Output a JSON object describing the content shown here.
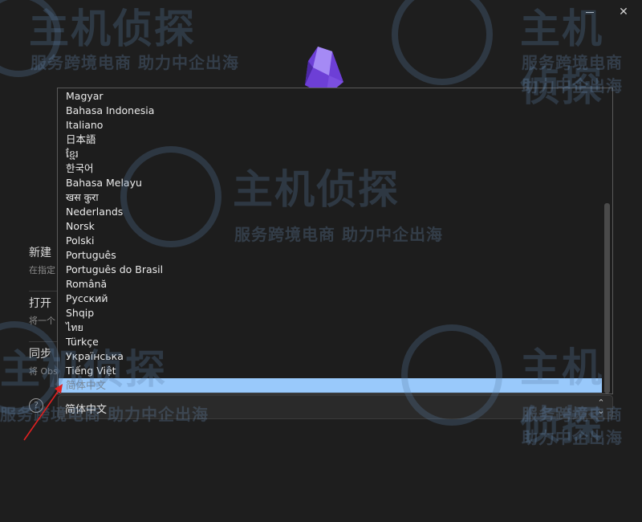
{
  "window": {
    "minimize_label": "minimize",
    "close_glyph": "✕"
  },
  "background_actions": [
    {
      "title": "新建",
      "desc": "在指定"
    },
    {
      "title": "打开",
      "desc": "将一个"
    },
    {
      "title": "同步",
      "desc": "将 Obs"
    }
  ],
  "help": {
    "glyph": "?"
  },
  "language_select": {
    "value": "简体中文",
    "chevron": "⌃⌄"
  },
  "language_options": [
    "Magyar",
    "Bahasa Indonesia",
    "Italiano",
    "日本語",
    "ខ្មែរ",
    "한국어",
    "Bahasa Melayu",
    "खस कुरा",
    "Nederlands",
    "Norsk",
    "Polski",
    "Português",
    "Português do Brasil",
    "Română",
    "Русский",
    "Shqip",
    "ไทย",
    "Türkçe",
    "Українська",
    "Tiếng Việt",
    "简体中文"
  ],
  "selected_option_index": 20,
  "watermark": {
    "big": "主机侦探",
    "small": "服务跨境电商 助力中企出海"
  },
  "colors": {
    "accent_selected": "#99c9fb",
    "logo_purple": "#8b5cf6",
    "annotation_red": "#e02020"
  },
  "icons": {
    "logo": "obsidian-logo-icon",
    "help": "help-circle-icon",
    "chevron": "chevron-updown-icon",
    "arrow": "red-arrow-annotation"
  }
}
